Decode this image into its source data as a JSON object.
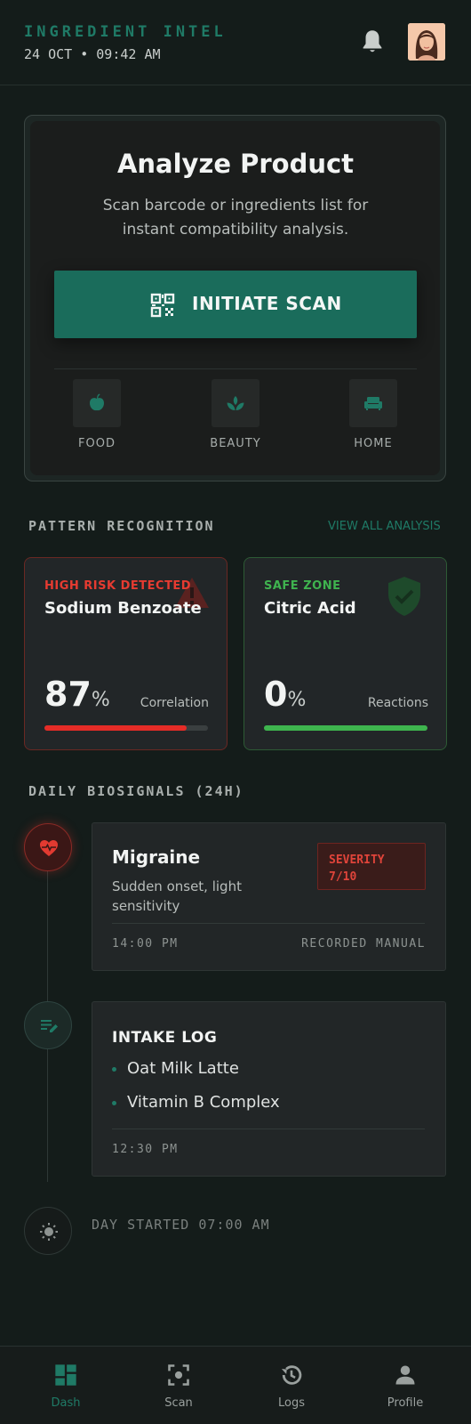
{
  "header": {
    "app_title": "INGREDIENT INTEL",
    "datetime": "24 OCT • 09:42 AM",
    "notification_icon": "bell-icon",
    "avatar_icon": "user-avatar"
  },
  "analyze": {
    "title": "Analyze Product",
    "description": "Scan barcode or ingredients list for instant compatibility analysis.",
    "scan_button": "INITIATE SCAN",
    "scan_icon": "qr-code-icon",
    "categories": [
      {
        "label": "FOOD",
        "icon": "apple-icon"
      },
      {
        "label": "BEAUTY",
        "icon": "leaf-icon"
      },
      {
        "label": "HOME",
        "icon": "sofa-icon"
      }
    ]
  },
  "patterns": {
    "section_title": "PATTERN RECOGNITION",
    "view_all": "VIEW ALL ANALYSIS",
    "cards": [
      {
        "tag": "HIGH RISK DETECTED",
        "name": "Sodium Benzoate",
        "value": "87",
        "unit": "%",
        "metric": "Correlation",
        "fill_percent": 87,
        "icon": "warning-icon",
        "color": "#e63b31"
      },
      {
        "tag": "SAFE ZONE",
        "name": "Citric Acid",
        "value": "0",
        "unit": "%",
        "metric": "Reactions",
        "fill_percent": 100,
        "icon": "shield-check-icon",
        "color": "#3fb34f"
      }
    ]
  },
  "biosignals": {
    "section_title": "DAILY BIOSIGNALS (24H)",
    "migraine": {
      "title": "Migraine",
      "description": "Sudden onset, light sensitivity",
      "severity_label": "SEVERITY",
      "severity_value": "7/10",
      "time": "14:00 PM",
      "source": "RECORDED MANUAL",
      "icon": "heart-pulse-icon"
    },
    "intake": {
      "title": "INTAKE LOG",
      "items": [
        "Oat Milk Latte",
        "Vitamin B Complex"
      ],
      "time": "12:30 PM",
      "icon": "edit-list-icon"
    },
    "day_started": "DAY STARTED 07:00 AM",
    "day_icon": "sun-icon"
  },
  "nav": {
    "items": [
      {
        "label": "Dash",
        "icon": "dashboard-icon",
        "active": true
      },
      {
        "label": "Scan",
        "icon": "scan-icon",
        "active": false
      },
      {
        "label": "Logs",
        "icon": "history-icon",
        "active": false
      },
      {
        "label": "Profile",
        "icon": "person-icon",
        "active": false
      }
    ]
  }
}
